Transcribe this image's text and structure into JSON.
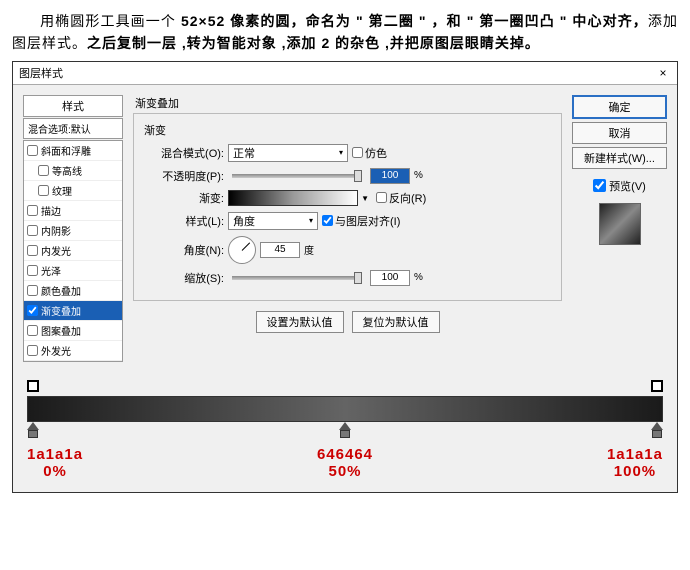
{
  "instruction": {
    "t1": "用椭圆形工具画一个 ",
    "b1": "52×52 像素的圆，命名为 \" 第二圈 \" ，和 \" 第一圈凹凸 \" 中心对齐，",
    "t2": "添加图层样式。",
    "b2": "之后复制一层 ,转为智能对象 ,添加 2 的杂色 ,并把原图层眼睛关掉。"
  },
  "dialog": {
    "title": "图层样式",
    "close": "×"
  },
  "styles": {
    "header": "样式",
    "subheader": "混合选项:默认",
    "items": [
      {
        "label": "斜面和浮雕",
        "checked": false
      },
      {
        "label": "等高线",
        "checked": false,
        "indent": true
      },
      {
        "label": "纹理",
        "checked": false,
        "indent": true
      },
      {
        "label": "描边",
        "checked": false
      },
      {
        "label": "内阴影",
        "checked": false
      },
      {
        "label": "内发光",
        "checked": false
      },
      {
        "label": "光泽",
        "checked": false
      },
      {
        "label": "颜色叠加",
        "checked": false
      },
      {
        "label": "渐变叠加",
        "checked": true,
        "hl": true
      },
      {
        "label": "图案叠加",
        "checked": false
      },
      {
        "label": "外发光",
        "checked": false
      }
    ]
  },
  "center": {
    "group_label": "渐变叠加",
    "group_title": "渐变",
    "blend_mode_label": "混合模式(O):",
    "blend_mode_value": "正常",
    "dither": "仿色",
    "opacity_label": "不透明度(P):",
    "opacity_value": "100",
    "pct": "%",
    "gradient_label": "渐变:",
    "reverse": "反向(R)",
    "style_label": "样式(L):",
    "style_value": "角度",
    "align": "与图层对齐(I)",
    "angle_label": "角度(N):",
    "angle_value": "45",
    "angle_unit": "度",
    "scale_label": "缩放(S):",
    "scale_value": "100",
    "btn_default": "设置为默认值",
    "btn_reset": "复位为默认值"
  },
  "right": {
    "ok": "确定",
    "cancel": "取消",
    "new_style": "新建样式(W)...",
    "preview": "预览(V)"
  },
  "stops": [
    {
      "color": "1a1a1a",
      "pos": "0%"
    },
    {
      "color": "646464",
      "pos": "50%"
    },
    {
      "color": "1a1a1a",
      "pos": "100%"
    }
  ],
  "chart_data": {
    "type": "gradient",
    "stops": [
      {
        "position": 0,
        "color": "#1a1a1a"
      },
      {
        "position": 50,
        "color": "#646464"
      },
      {
        "position": 100,
        "color": "#1a1a1a"
      }
    ]
  }
}
